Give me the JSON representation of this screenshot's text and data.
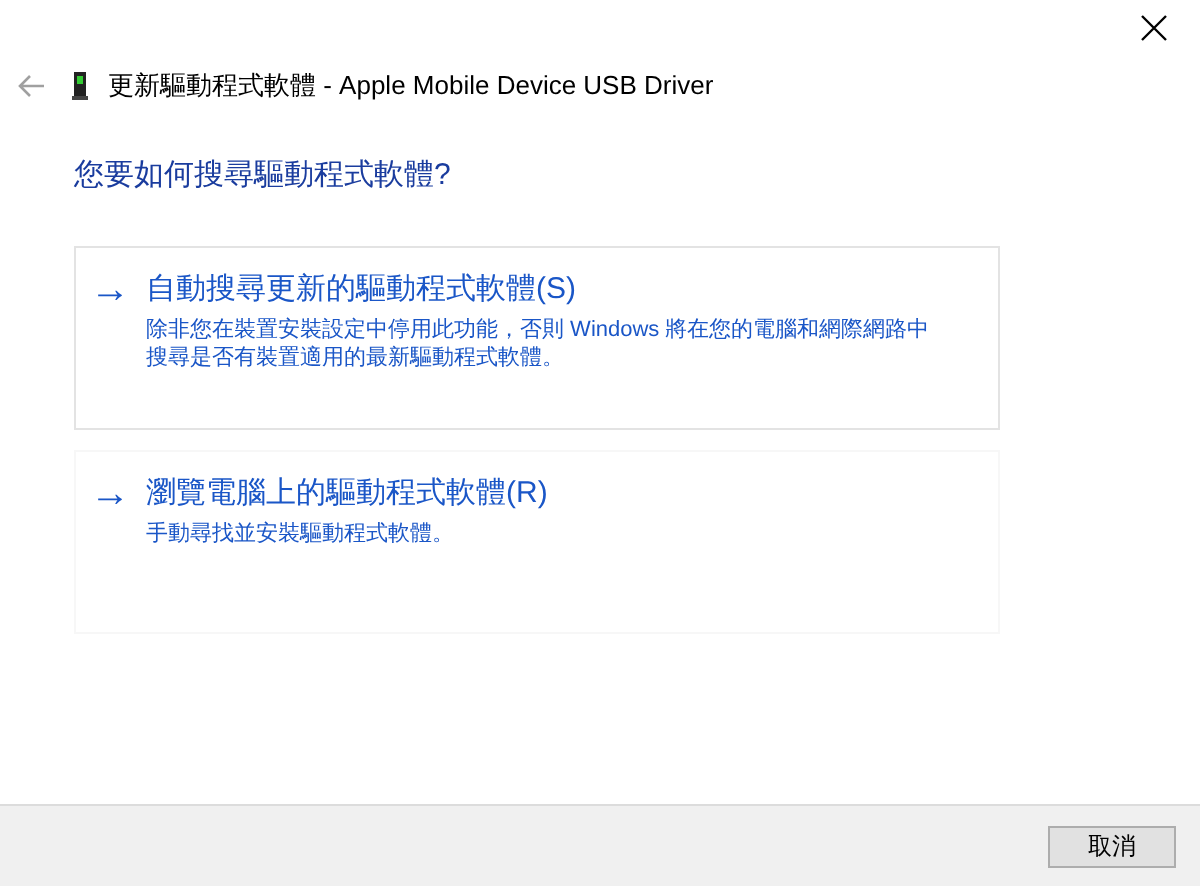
{
  "window": {
    "title": "更新驅動程式軟體 - Apple Mobile Device USB Driver"
  },
  "heading": "您要如何搜尋驅動程式軟體?",
  "options": [
    {
      "arrow": "→",
      "title": "自動搜尋更新的驅動程式軟體(S)",
      "description": "除非您在裝置安裝設定中停用此功能，否則 Windows 將在您的電腦和網際網路中搜尋是否有裝置適用的最新驅動程式軟體。",
      "selected": true
    },
    {
      "arrow": "→",
      "title": "瀏覽電腦上的驅動程式軟體(R)",
      "description": "手動尋找並安裝驅動程式軟體。",
      "selected": false
    }
  ],
  "buttons": [
    "取消"
  ]
}
